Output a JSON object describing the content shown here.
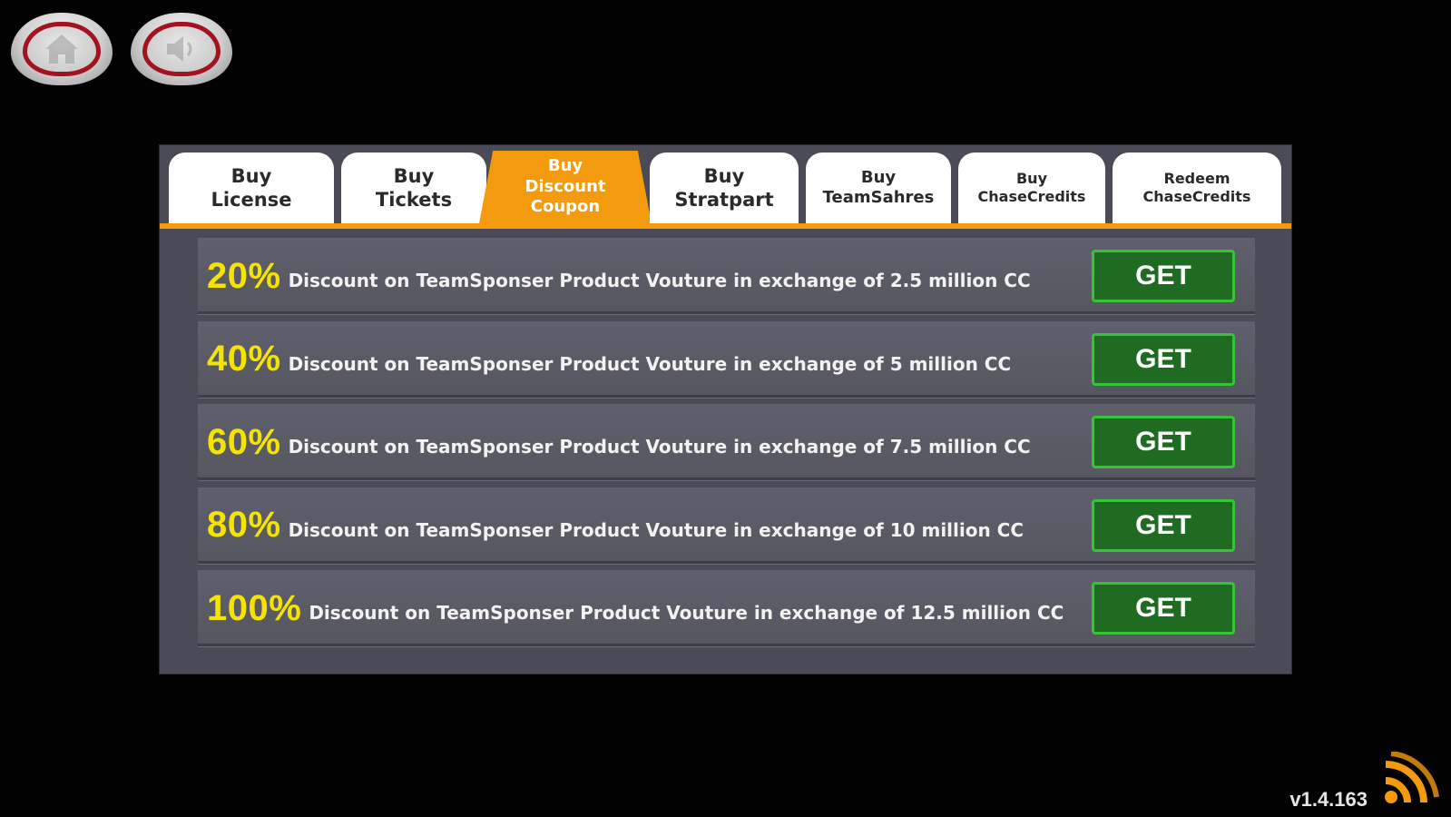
{
  "tabs": [
    {
      "label": "Buy\nLicense",
      "active": false
    },
    {
      "label": "Buy\nTickets",
      "active": false
    },
    {
      "label": "Buy\nDiscount\nCoupon",
      "active": true
    },
    {
      "label": "Buy\nStratpart",
      "active": false
    },
    {
      "label": "Buy\nTeamSahres",
      "active": false
    },
    {
      "label": "Buy\nChaseCredits",
      "active": false
    },
    {
      "label": "Redeem\nChaseCredits",
      "active": false
    }
  ],
  "coupons": [
    {
      "percent": "20%",
      "description": "Discount on TeamSponser Product Vouture in exchange of 2.5 million CC",
      "button": "GET"
    },
    {
      "percent": "40%",
      "description": "Discount on TeamSponser Product Vouture in exchange of 5 million CC",
      "button": "GET"
    },
    {
      "percent": "60%",
      "description": "Discount on TeamSponser Product Vouture in exchange of 7.5 million CC",
      "button": "GET"
    },
    {
      "percent": "80%",
      "description": "Discount on TeamSponser Product Vouture in exchange of 10 million CC",
      "button": "GET"
    },
    {
      "percent": "100%",
      "description": "Discount on TeamSponser Product Vouture in exchange of 12.5 million CC",
      "button": "GET"
    }
  ],
  "version": "v1.4.163",
  "icons": {
    "home": "home-icon",
    "sound": "speaker-icon",
    "connection": "wifi-icon"
  },
  "colors": {
    "accent": "#f39a0f",
    "percent": "#f5e400",
    "get_button": "#1f6b22",
    "get_border": "#37c23a",
    "panel": "#4a4b57"
  }
}
